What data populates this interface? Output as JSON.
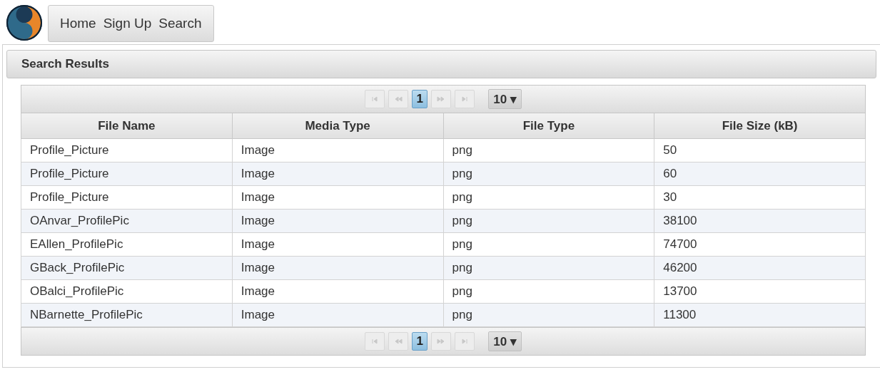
{
  "nav": {
    "links": [
      "Home",
      "Sign Up",
      "Search"
    ]
  },
  "panel": {
    "title": "Search Results"
  },
  "paginators": [
    {
      "buttons": [
        {
          "kind": "first",
          "disabled": true
        },
        {
          "kind": "prev",
          "disabled": true
        }
      ],
      "pages": [
        {
          "label": "1",
          "selected": true
        }
      ],
      "after": [
        {
          "kind": "next",
          "disabled": true
        },
        {
          "kind": "last",
          "disabled": true
        }
      ],
      "rows_per_page": "10 ▾"
    },
    {
      "buttons": [
        {
          "kind": "first",
          "disabled": true
        },
        {
          "kind": "prev",
          "disabled": true
        }
      ],
      "pages": [
        {
          "label": "1",
          "selected": true
        }
      ],
      "after": [
        {
          "kind": "next",
          "disabled": true
        },
        {
          "kind": "last",
          "disabled": true
        }
      ],
      "rows_per_page": "10 ▾"
    }
  ],
  "table": {
    "columns": [
      "File Name",
      "Media Type",
      "File Type",
      "File Size (kB)"
    ],
    "rows": [
      [
        "Profile_Picture",
        "Image",
        "png",
        "50"
      ],
      [
        "Profile_Picture",
        "Image",
        "png",
        "60"
      ],
      [
        "Profile_Picture",
        "Image",
        "png",
        "30"
      ],
      [
        "OAnvar_ProfilePic",
        "Image",
        "png",
        "38100"
      ],
      [
        "EAllen_ProfilePic",
        "Image",
        "png",
        "74700"
      ],
      [
        "GBack_ProfilePic",
        "Image",
        "png",
        "46200"
      ],
      [
        "OBalci_ProfilePic",
        "Image",
        "png",
        "13700"
      ],
      [
        "NBarnette_ProfilePic",
        "Image",
        "png",
        "11300"
      ]
    ]
  }
}
